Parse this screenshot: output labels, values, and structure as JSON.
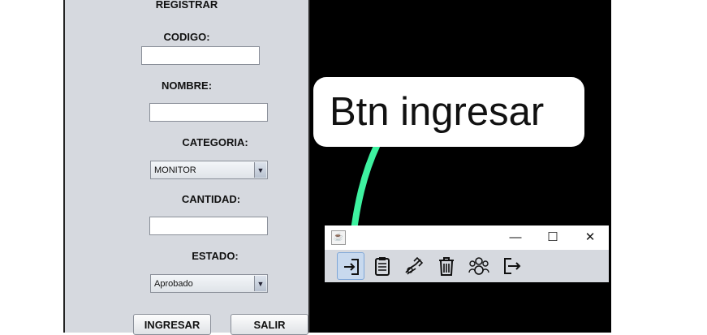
{
  "form": {
    "title": "REGISTRAR",
    "codigo_label": "CODIGO:",
    "codigo_value": "",
    "nombre_label": "NOMBRE:",
    "nombre_value": "",
    "categoria_label": "CATEGORIA:",
    "categoria_value": "MONITOR",
    "cantidad_label": "CANTIDAD:",
    "cantidad_value": "",
    "estado_label": "ESTADO:",
    "estado_value": "Aprobado",
    "ingresar_label": "INGRESAR",
    "salir_label": "SALIR"
  },
  "callout": {
    "text": "Btn ingresar",
    "pointer_color": "#3ef2a0"
  },
  "mini_window": {
    "title_icon": "java-icon",
    "minimize_glyph": "—",
    "maximize_glyph": "☐",
    "close_glyph": "✕",
    "tools": [
      "login-icon",
      "clipboard-list-icon",
      "settings-hand-icon",
      "trash-icon",
      "user-group-icon",
      "logout-icon"
    ]
  },
  "colors": {
    "panel_bg": "#d6d9df",
    "background": "#000000",
    "selected_tool": "#c8d9ee"
  }
}
